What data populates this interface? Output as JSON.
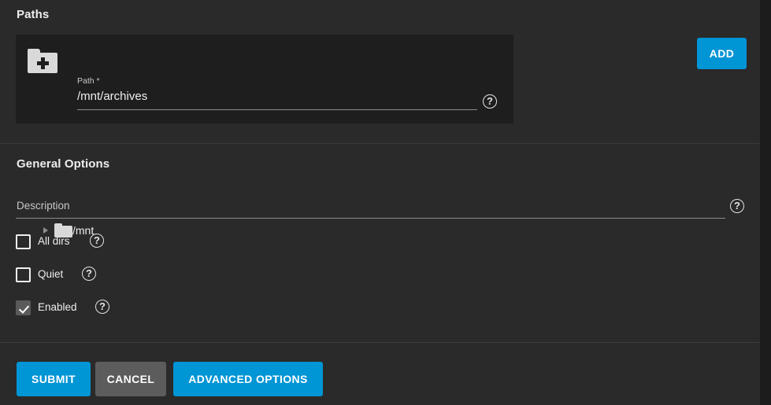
{
  "paths_section": {
    "title": "Paths",
    "path_field": {
      "label": "Path *",
      "value": "/mnt/archives",
      "help_glyph": "?"
    },
    "add_button_label": "ADD",
    "tree": {
      "items": [
        {
          "label": "/mnt",
          "expanded": false
        }
      ]
    }
  },
  "general_options": {
    "title": "General Options",
    "description_field": {
      "placeholder": "Description",
      "value": "",
      "help_glyph": "?"
    },
    "checkboxes": [
      {
        "label": "All dirs",
        "checked": false,
        "help_glyph": "?"
      },
      {
        "label": "Quiet",
        "checked": false,
        "help_glyph": "?"
      },
      {
        "label": "Enabled",
        "checked": true,
        "help_glyph": "?"
      }
    ]
  },
  "footer": {
    "submit_label": "SUBMIT",
    "cancel_label": "CANCEL",
    "advanced_label": "ADVANCED OPTIONS"
  },
  "colors": {
    "page_background": "#2a2a2a",
    "card_background": "#1e1e1e",
    "accent_blue": "#0095d5",
    "neutral_gray": "#5c5c5c",
    "divider": "#3a3a3a",
    "text_primary": "#ededed"
  }
}
